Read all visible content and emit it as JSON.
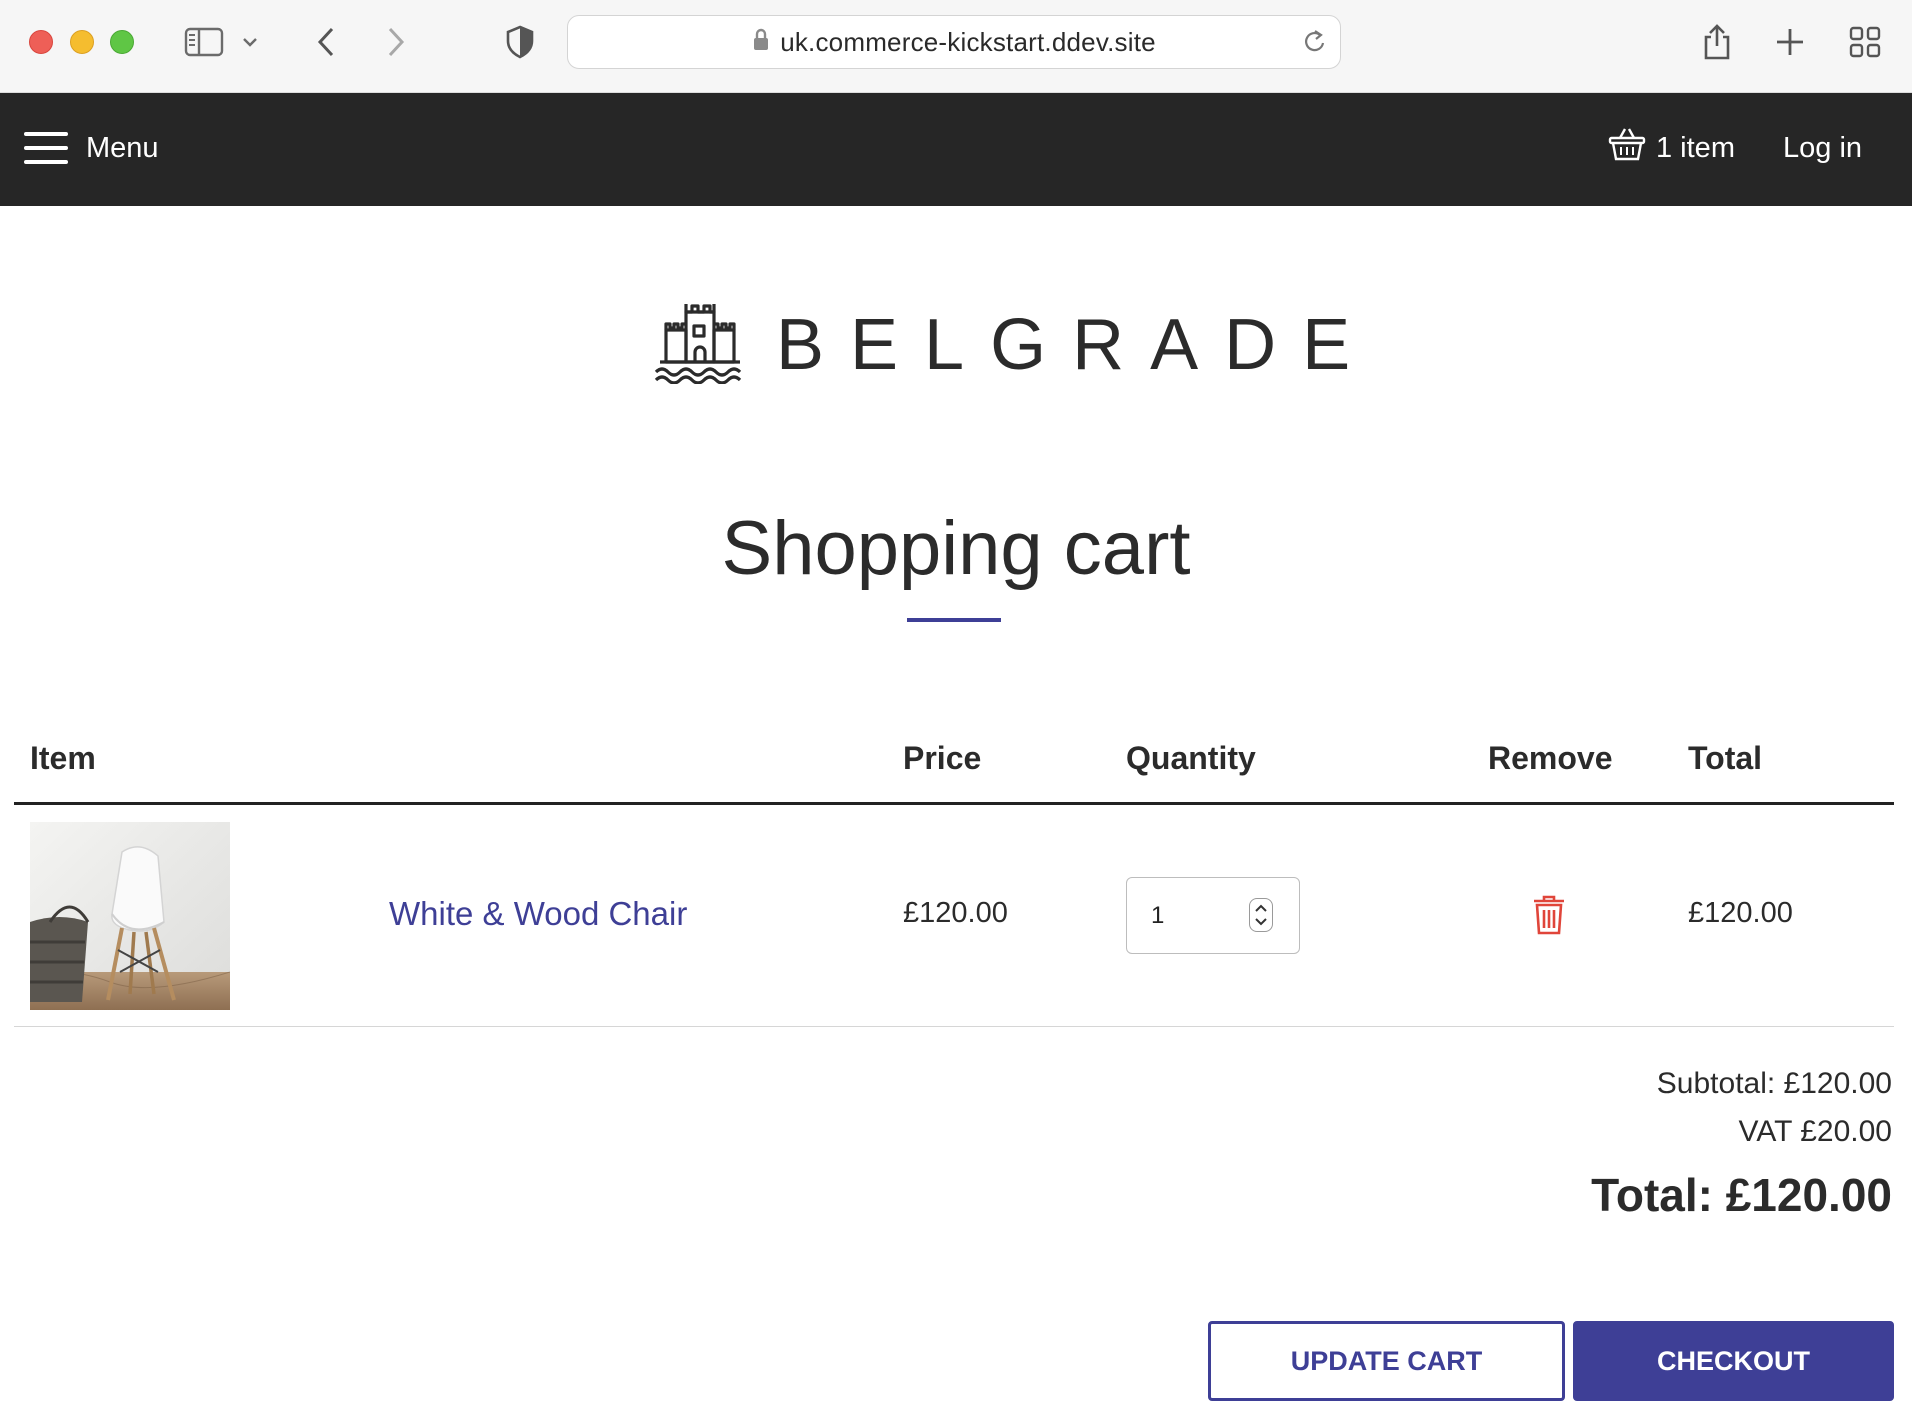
{
  "browser": {
    "url": "uk.commerce-kickstart.ddev.site"
  },
  "nav": {
    "menu_label": "Menu",
    "cart_label": "1 item",
    "login_label": "Log in"
  },
  "site": {
    "logo_text": "BELGRADE"
  },
  "page": {
    "title": "Shopping cart"
  },
  "table": {
    "headers": {
      "item": "Item",
      "price": "Price",
      "quantity": "Quantity",
      "remove": "Remove",
      "total": "Total"
    },
    "rows": [
      {
        "product": "White & Wood Chair",
        "price": "£120.00",
        "quantity": "1",
        "total": "£120.00"
      }
    ]
  },
  "summary": {
    "subtotal": "Subtotal: £120.00",
    "vat": "VAT £20.00",
    "total": "Total: £120.00"
  },
  "actions": {
    "update_label": "UPDATE CART",
    "checkout_label": "CHECKOUT"
  },
  "colors": {
    "accent": "#3e3f96",
    "nav_bg": "#262626",
    "remove_icon": "#e0453a"
  }
}
